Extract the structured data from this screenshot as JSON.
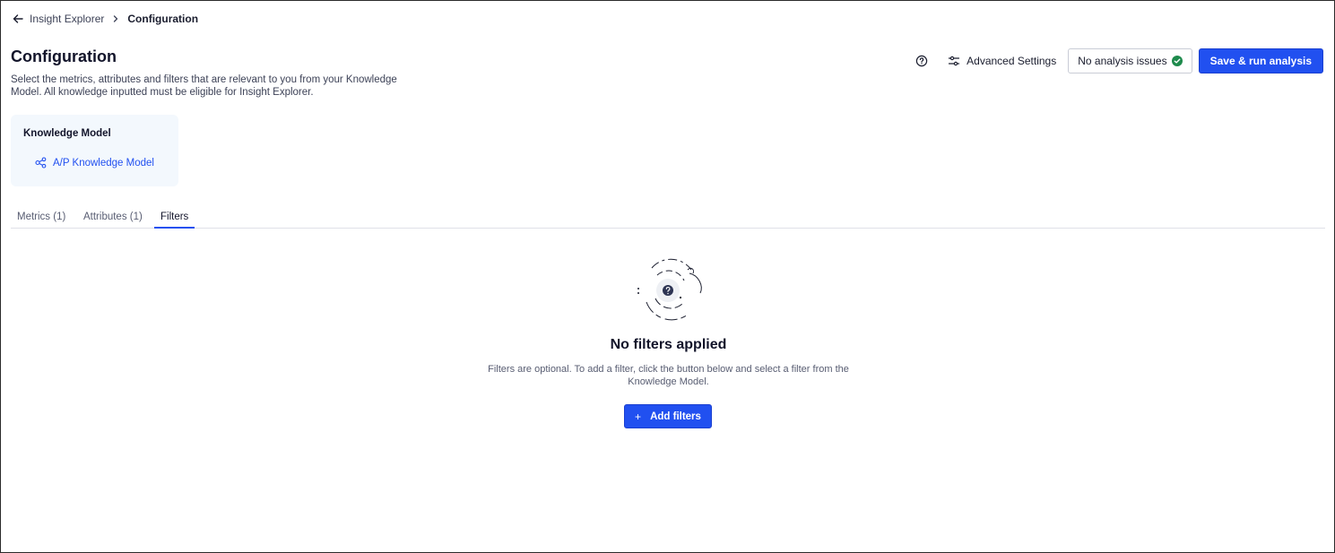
{
  "breadcrumb": {
    "parent": "Insight Explorer",
    "current": "Configuration"
  },
  "header": {
    "title": "Configuration",
    "description": "Select the metrics, attributes and filters that are relevant to you from your Knowledge Model. All knowledge inputted must be eligible for Insight Explorer."
  },
  "actions": {
    "advanced_settings_label": "Advanced Settings",
    "issues_label": "No analysis issues",
    "run_label": "Save & run analysis"
  },
  "knowledge_model": {
    "title": "Knowledge Model",
    "link_label": "A/P Knowledge Model"
  },
  "tabs": [
    {
      "label": "Metrics (1)",
      "active": false
    },
    {
      "label": "Attributes (1)",
      "active": false
    },
    {
      "label": "Filters",
      "active": true
    }
  ],
  "empty_state": {
    "title": "No filters applied",
    "text": "Filters are optional. To add a filter, click the button below and select a filter from the Knowledge Model.",
    "button_label": "Add filters",
    "button_icon": "plus-icon"
  },
  "colors": {
    "accent": "#2150f0",
    "success": "#1e8a4c"
  }
}
